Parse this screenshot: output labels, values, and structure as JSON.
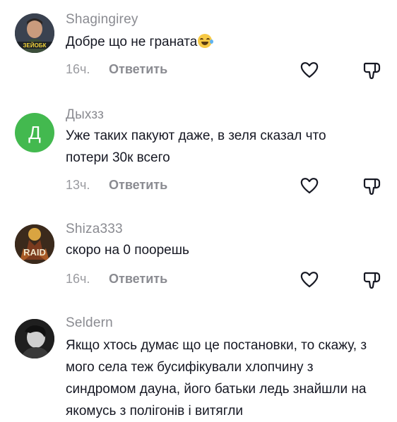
{
  "comments": [
    {
      "username": "Shagingirey",
      "text": "Добре що не граната",
      "emoji": "laughing-with-tears",
      "time": "16ч.",
      "reply_label": "Ответить",
      "avatar_caption": "ЗЕЙОБК",
      "avatar_style": "photo"
    },
    {
      "username": "Дыхзз",
      "text": "Уже таких пакуют даже, в зеля сказал что потери 30к всего",
      "time": "13ч.",
      "reply_label": "Ответить",
      "avatar_letter": "Д",
      "avatar_color": "#43b94f"
    },
    {
      "username": "Shiza333",
      "text": "скоро на 0 поорешь",
      "time": "16ч.",
      "reply_label": "Ответить",
      "avatar_caption": "RAID",
      "avatar_style": "game-art"
    },
    {
      "username": "Seldern",
      "text": "Якщо хтось думає що це постановки, то скажу, з мого села теж бусифікували хлопчину з синдромом дауна, його батьки ледь знайшли на якомусь з полігонів і витягли",
      "avatar_style": "monochrome-photo"
    }
  ],
  "icons": {
    "like": "heart-outline-icon",
    "dislike": "thumbs-down-outline-icon"
  },
  "colors": {
    "text": "#161823",
    "secondary": "#8a8b91",
    "avatar_green": "#43b94f"
  }
}
